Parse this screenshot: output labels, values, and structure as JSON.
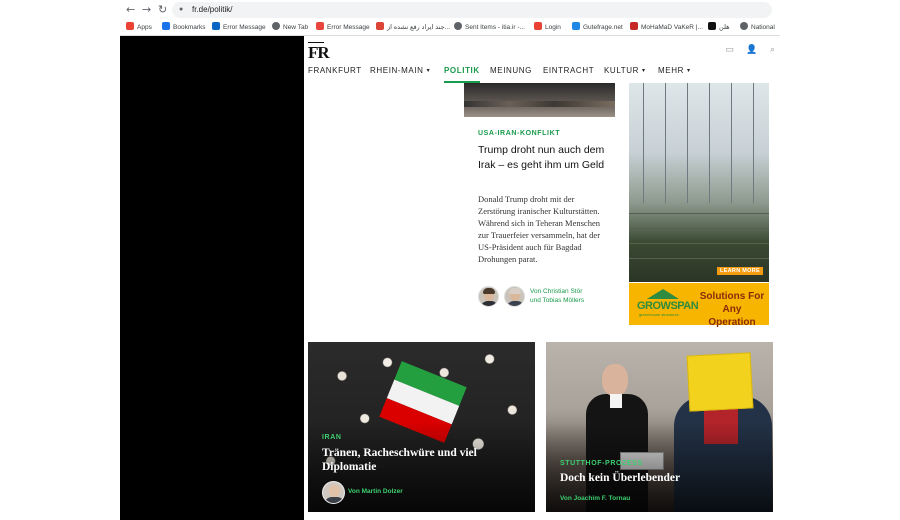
{
  "browser": {
    "url": "fr.de/politik/",
    "back_glyph": "←",
    "forward_glyph": "→",
    "reload_glyph": "↻",
    "bookmarks": [
      {
        "label": "Apps",
        "color": "#ea4335"
      },
      {
        "label": "Bookmarks",
        "color": "#1a73e8"
      },
      {
        "label": "Error Message",
        "color": "#0a66c2"
      },
      {
        "label": "New Tab",
        "color": "#5f6368"
      },
      {
        "label": "Error Message",
        "color": "#e8453c"
      },
      {
        "label": "جند ایراد رفع نشده از...",
        "color": "#db4437"
      },
      {
        "label": "Sent Items - itia.ir -...",
        "color": "#5f6368"
      },
      {
        "label": "Login",
        "color": "#e94235"
      },
      {
        "label": "Gutefrage.net",
        "color": "#1e88e5"
      },
      {
        "label": "MoHaMaD VaKeR |...",
        "color": "#c62828"
      },
      {
        "label": "هلن",
        "color": "#111111"
      },
      {
        "label": "National",
        "color": "#5f6368"
      }
    ]
  },
  "site": {
    "logo": "FR",
    "icons": [
      "screen-icon",
      "user-icon",
      "search-icon"
    ],
    "icon_glyphs": [
      "▭",
      "👤",
      "⌕"
    ],
    "nav": [
      {
        "label": "FRANKFURT",
        "caret": ""
      },
      {
        "label": "RHEIN-MAIN",
        "caret": "▾"
      },
      {
        "label": "POLITIK",
        "caret": ""
      },
      {
        "label": "MEINUNG",
        "caret": ""
      },
      {
        "label": "EINTRACHT",
        "caret": ""
      },
      {
        "label": "KULTUR",
        "caret": "▾"
      },
      {
        "label": "MEHR",
        "caret": "▾"
      }
    ],
    "active_nav": "POLITIK",
    "accent_color": "#1a9a4b"
  },
  "article": {
    "kicker": "USA-IRAN-KONFLIKT",
    "headline": "Trump droht nun auch dem Irak – es geht ihm um Geld",
    "teaser": "Donald Trump droht mit der Zerstörung iranischer Kulturstätten. Während sich in Teheran Menschen zur Trauerfeier versammeln, hat der US-Präsident auch für Bagdad Drohungen parat.",
    "byline_line1": "Von Christian Stör",
    "byline_line2": "und Tobias Möllers"
  },
  "ad": {
    "learn_more": "LEARN MORE",
    "brand": "GROWSPAN",
    "brand_sub": "greenhouse structures",
    "tagline": "Solutions For Any Operation"
  },
  "cards": [
    {
      "kicker": "IRAN",
      "title": "Tränen, Racheschwüre und viel Diplomatie",
      "byline": "Von Martin Dolzer"
    },
    {
      "kicker": "STUTTHOF-PROZESS",
      "title": "Doch kein Überlebender",
      "byline": "Von Joachim F. Tornau"
    }
  ]
}
